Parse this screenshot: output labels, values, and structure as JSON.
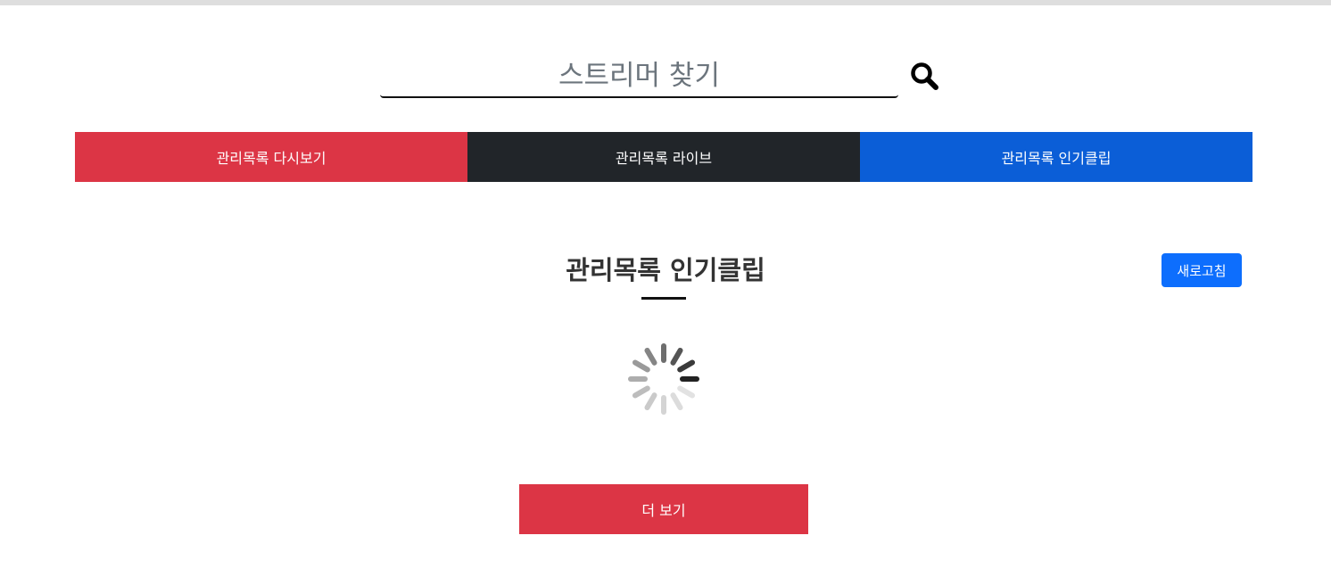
{
  "search": {
    "value": "",
    "placeholder": "스트리머 찾기",
    "icon": "magnifier-icon"
  },
  "tabs": [
    {
      "label": "관리목록 다시보기",
      "color": "#dc3545"
    },
    {
      "label": "관리목록 라이브",
      "color": "#212529"
    },
    {
      "label": "관리목록 인기클립",
      "color": "#0b5ed7"
    }
  ],
  "main": {
    "title": "관리목록 인기클립",
    "refresh_label": "새로고침",
    "loading_icon": "loading-spinner-icon",
    "more_label": "더 보기"
  },
  "colors": {
    "red": "#dc3545",
    "dark": "#212529",
    "blue": "#0b5ed7",
    "primary": "#0d6efd"
  }
}
